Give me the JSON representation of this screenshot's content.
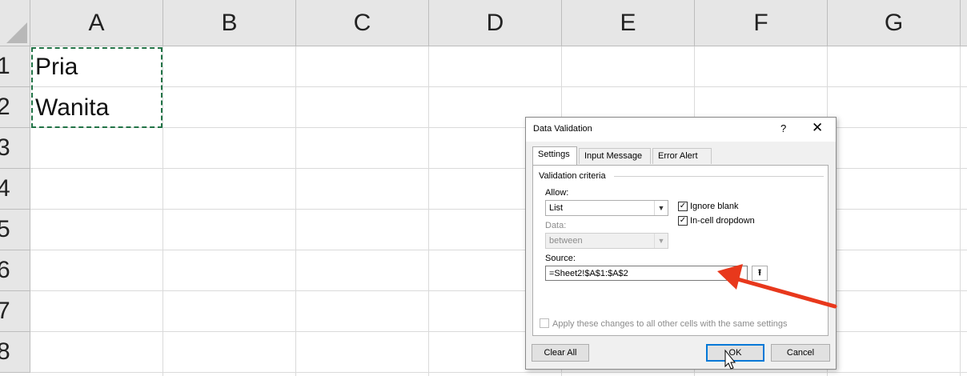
{
  "sheet": {
    "columns": [
      "A",
      "B",
      "C",
      "D",
      "E",
      "F",
      "G"
    ],
    "rows": [
      "1",
      "2",
      "3",
      "4",
      "5",
      "6",
      "7",
      "8"
    ],
    "cells": {
      "A1": "Pria",
      "A2": "Wanita"
    }
  },
  "dialog": {
    "title": "Data Validation",
    "help_label": "?",
    "close_label": "✕",
    "tabs": [
      "Settings",
      "Input Message",
      "Error Alert"
    ],
    "active_tab": "Settings",
    "section_label": "Validation criteria",
    "allow": {
      "label": "Allow:",
      "value": "List"
    },
    "data": {
      "label": "Data:",
      "value": "between"
    },
    "ignore_blank": {
      "label": "Ignore blank",
      "checked": true
    },
    "in_cell_dropdown": {
      "label": "In-cell dropdown",
      "checked": true
    },
    "source": {
      "label": "Source:",
      "value": "=Sheet2!$A$1:$A$2"
    },
    "apply_all": {
      "label": "Apply these changes to all other cells with the same settings",
      "checked": false
    },
    "buttons": {
      "clear_all": "Clear All",
      "ok": "OK",
      "cancel": "Cancel"
    }
  },
  "annotation": {
    "arrow_color": "#e8381c"
  },
  "icons": {
    "dropdown": "chevron-down-icon",
    "collapse": "collapse-dialog-icon",
    "cursor": "mouse-pointer-icon"
  },
  "colors": {
    "selection": "#217346",
    "header_bg": "#e6e6e6",
    "ok_border": "#0078d7"
  }
}
